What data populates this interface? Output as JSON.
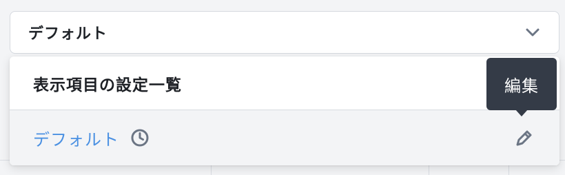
{
  "select": {
    "value": "デフォルト",
    "icon": "chevron-down-icon"
  },
  "dropdown": {
    "title": "表示項目の設定一覧",
    "options": [
      {
        "label": "デフォルト",
        "status_icon": "clock-icon",
        "action_icon": "pencil-icon"
      }
    ]
  },
  "tooltip": {
    "text": "編集"
  },
  "colors": {
    "link": "#4a90e2",
    "tooltip_bg": "#343b47",
    "icon_gray": "#6b7584"
  }
}
